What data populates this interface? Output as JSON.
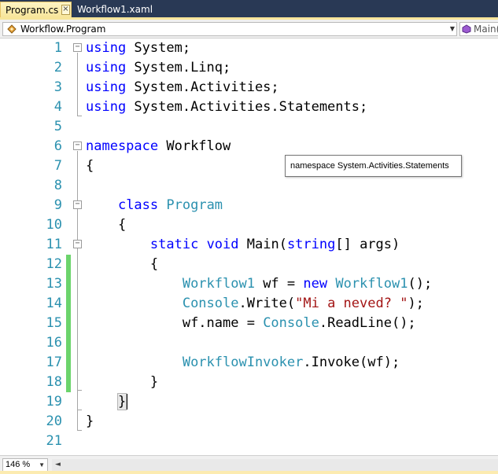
{
  "tabs": [
    {
      "label": "Program.cs",
      "active": true
    },
    {
      "label": "Workflow1.xaml",
      "active": false
    }
  ],
  "navbar": {
    "type_combo": "Workflow.Program",
    "member_combo": "Main("
  },
  "tooltip": "namespace System.Activities.Statements",
  "zoom": "146 %",
  "colors": {
    "keyword": "#0000ff",
    "type": "#2b91af",
    "string": "#a31515",
    "line_number": "#2b91af",
    "change_bar": "#6cd46c",
    "tab_active": "#f7e59a",
    "chrome": "#293955"
  },
  "lines": [
    {
      "n": "1"
    },
    {
      "n": "2"
    },
    {
      "n": "3"
    },
    {
      "n": "4"
    },
    {
      "n": "5"
    },
    {
      "n": "6"
    },
    {
      "n": "7"
    },
    {
      "n": "8"
    },
    {
      "n": "9"
    },
    {
      "n": "10"
    },
    {
      "n": "11"
    },
    {
      "n": "12"
    },
    {
      "n": "13"
    },
    {
      "n": "14"
    },
    {
      "n": "15"
    },
    {
      "n": "16"
    },
    {
      "n": "17"
    },
    {
      "n": "18"
    },
    {
      "n": "19"
    },
    {
      "n": "20"
    },
    {
      "n": "21"
    }
  ],
  "code": {
    "l1": [
      "using",
      " System;"
    ],
    "l2": [
      "using",
      " System.Linq;"
    ],
    "l3": [
      "using",
      " System.Activities;"
    ],
    "l4": [
      "using",
      " System.Activities.Statements;"
    ],
    "l6": [
      "namespace",
      " Workflow"
    ],
    "l7": "{",
    "l9": [
      "class",
      " ",
      "Program"
    ],
    "l10": "{",
    "l11": [
      "static",
      " ",
      "void",
      " Main(",
      "string",
      "[] args)"
    ],
    "l12": "{",
    "l13": [
      "Workflow1",
      " wf = ",
      "new",
      " ",
      "Workflow1",
      "();"
    ],
    "l14": [
      "Console",
      ".Write(",
      "\"Mi a neved? \"",
      ");"
    ],
    "l15": [
      "wf.name = ",
      "Console",
      ".ReadLine();"
    ],
    "l17": [
      "WorkflowInvoker",
      ".Invoke(wf);"
    ],
    "l18": "}",
    "l19": "}",
    "l20": "}"
  }
}
